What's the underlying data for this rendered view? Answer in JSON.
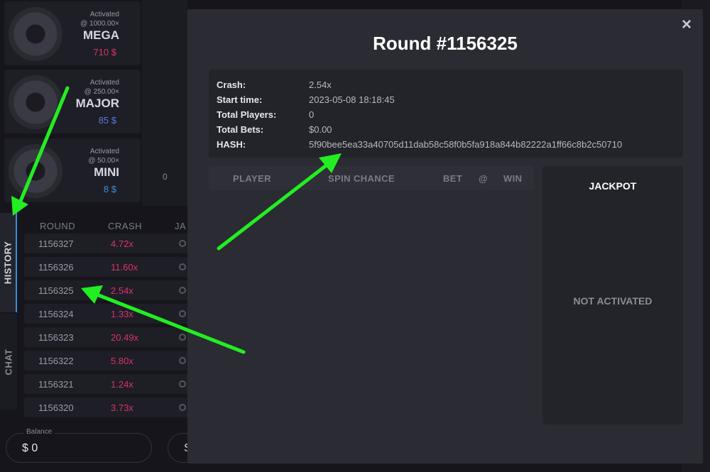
{
  "jackpots": [
    {
      "activated": "Activated",
      "threshold": "@ 1000.00×",
      "name": "MEGA",
      "amount": "710 $",
      "amount_color": "#d8326e"
    },
    {
      "activated": "Activated",
      "threshold": "@ 250.00×",
      "name": "MAJOR",
      "amount": "85 $",
      "amount_color": "#5a78d8"
    },
    {
      "activated": "Activated",
      "threshold": "@ 50.00×",
      "name": "MINI",
      "amount": "8 $",
      "amount_color": "#3a8fd8"
    }
  ],
  "chart_zero": "0",
  "tabs": {
    "history": "HISTORY",
    "chat": "CHAT"
  },
  "history": {
    "headers": {
      "round": "ROUND",
      "crash": "CRASH",
      "jackpot": "JA"
    },
    "rows": [
      {
        "round": "1156327",
        "crash": "4.72x"
      },
      {
        "round": "1156326",
        "crash": "11.60x"
      },
      {
        "round": "1156325",
        "crash": "2.54x"
      },
      {
        "round": "1156324",
        "crash": "1.33x"
      },
      {
        "round": "1156323",
        "crash": "20.49x"
      },
      {
        "round": "1156322",
        "crash": "5.80x"
      },
      {
        "round": "1156321",
        "crash": "1.24x"
      },
      {
        "round": "1156320",
        "crash": "3.73x"
      }
    ]
  },
  "balance": {
    "label": "Balance",
    "value": "$ 0"
  },
  "second_button": "S",
  "modal": {
    "close": "×",
    "title": "Round #1156325",
    "info": [
      {
        "label": "Crash:",
        "value": "2.54x"
      },
      {
        "label": "Start time:",
        "value": "2023-05-08 18:18:45"
      },
      {
        "label": "Total Players:",
        "value": "0"
      },
      {
        "label": "Total Bets:",
        "value": "$0.00"
      },
      {
        "label": "HASH:",
        "value": "5f90bee5ea33a40705d11dab58c58f0b5fa918a844b82222a1ff66c8b2c50710"
      }
    ],
    "table_headers": {
      "player": "PLAYER",
      "spin_chance": "SPIN CHANCE",
      "bet": "BET",
      "at": "@",
      "win": "WIN"
    },
    "jackpot_panel": {
      "title": "JACKPOT",
      "status": "NOT ACTIVATED"
    }
  },
  "arrow_color": "#22ee22"
}
